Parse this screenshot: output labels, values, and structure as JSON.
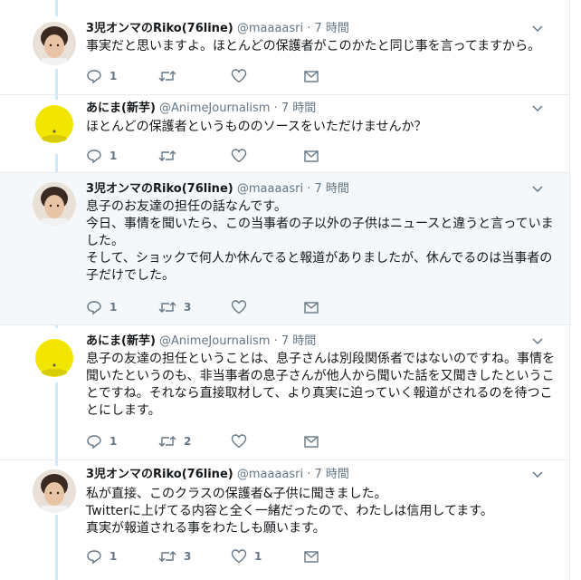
{
  "tweets": [
    {
      "author_name": "3児オンマのRiko(76line)",
      "handle": "@maaaasri",
      "time": "· 7 時間",
      "text": "事実だと思いますよ。ほとんどの保護者がこのかたと同じ事を言ってますから。",
      "reply_count": "1",
      "retweet_count": "",
      "like_count": "",
      "avatar": "person-photo"
    },
    {
      "author_name": "あにま(新芋)",
      "handle": "@AnimeJournalism",
      "time": "· 7 時間",
      "text": "ほとんどの保護者というもののソースをいただけませんか？",
      "reply_count": "1",
      "retweet_count": "",
      "like_count": "",
      "avatar": "yellow-ball"
    },
    {
      "author_name": "3児オンマのRiko(76line)",
      "handle": "@maaaasri",
      "time": "· 7 時間",
      "text": "息子のお友達の担任の話なんです。\n今日、事情を聞いたら、この当事者の子以外の子供はニュースと違うと言っていました。\nそして、ショックで何人か休んでると報道がありましたが、休んでるのは当事者の子だけでした。",
      "reply_count": "1",
      "retweet_count": "3",
      "like_count": "",
      "avatar": "person-photo"
    },
    {
      "author_name": "あにま(新芋)",
      "handle": "@AnimeJournalism",
      "time": "· 7 時間",
      "text": "息子の友達の担任ということは、息子さんは別段関係者ではないのですね。事情を聞いたというのも、非当事者の息子さんが他人から聞いた話を又聞きしたということですね。それなら直接取材して、より真実に迫っていく報道がされるのを待つことにします。",
      "reply_count": "1",
      "retweet_count": "2",
      "like_count": "",
      "avatar": "yellow-ball"
    },
    {
      "author_name": "3児オンマのRiko(76line)",
      "handle": "@maaaasri",
      "time": "· 7 時間",
      "text": "私が直接、このクラスの保護者&子供に聞きました。\nTwitterに上げてる内容と全く一緒だったので、わたしは信用してます。\n真実が報道される事をわたしも願います。",
      "reply_count": "1",
      "retweet_count": "3",
      "like_count": "1",
      "avatar": "person-photo"
    }
  ],
  "colors": {
    "thread_line": "#cfe9f9",
    "icon_gray": "#657786",
    "highlight_bg": "#f5f8fa"
  }
}
